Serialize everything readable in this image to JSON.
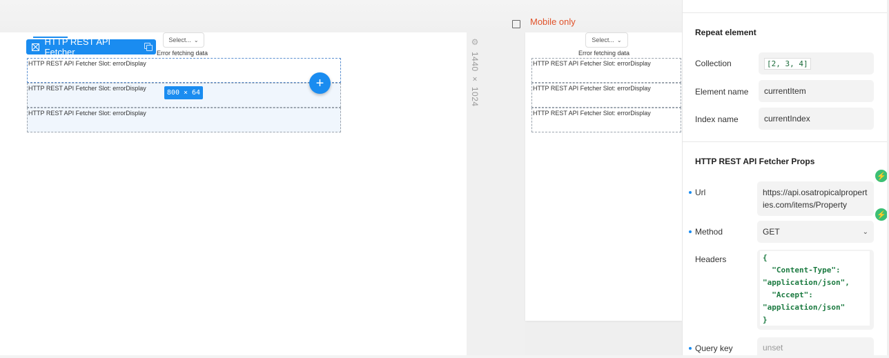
{
  "canvas": {
    "desktop_size": "1440 × 1024",
    "mobile_label": "Mobile only",
    "component_tag": "HTTP REST API Fetcher",
    "dimension_badge": "800 × 64",
    "add_button": "+",
    "select_label": "Select...",
    "select_chevron": "⌄",
    "error_text": "Error fetching data",
    "slot_label": "HTTP REST API Fetcher Slot: errorDisplay"
  },
  "panel": {
    "repeat": {
      "title": "Repeat element",
      "collection_label": "Collection",
      "collection_value": "[2, 3, 4]",
      "element_name_label": "Element name",
      "element_name_value": "currentItem",
      "index_name_label": "Index name",
      "index_name_value": "currentIndex"
    },
    "props": {
      "title": "HTTP REST API Fetcher Props",
      "url_label": "Url",
      "url_value": "https://api.osatropicalproperties.com/items/Property",
      "method_label": "Method",
      "method_value": "GET",
      "headers_label": "Headers",
      "headers_value": "{\n  \"Content-Type\":\n\"application/json\",\n  \"Accept\":\n\"application/json\"\n}",
      "query_key_label": "Query key",
      "query_key_placeholder": "unset"
    }
  },
  "colors": {
    "accent": "#1a8cf0",
    "mobile_label": "#e0522a",
    "code_green": "#1b7a40",
    "bolt_green": "#3cbf74"
  }
}
